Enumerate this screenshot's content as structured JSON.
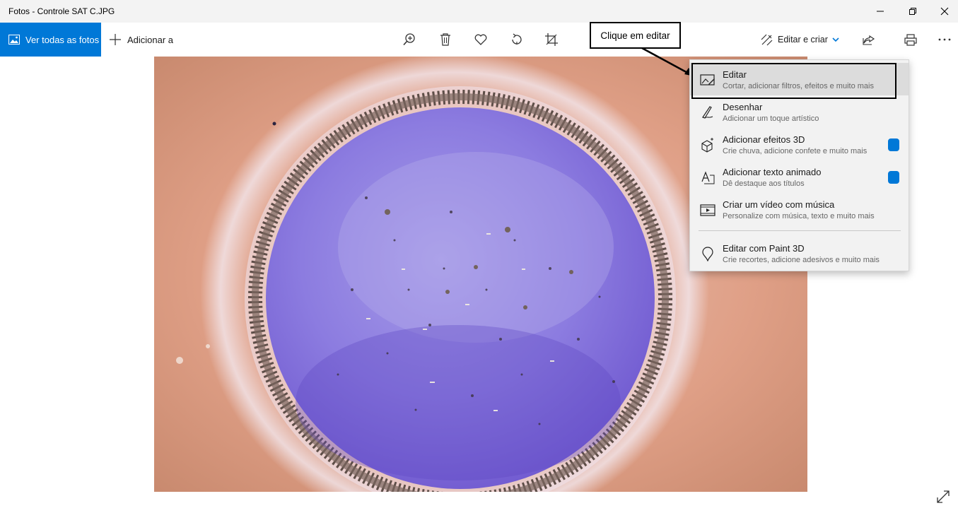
{
  "window": {
    "title": "Fotos - Controle SAT C.JPG"
  },
  "toolbar": {
    "view_all_label": "Ver todas as fotos",
    "add_to_label": "Adicionar a",
    "edit_create_label": "Editar e criar"
  },
  "callout": {
    "text": "Clique em editar"
  },
  "menu": {
    "items": [
      {
        "title": "Editar",
        "subtitle": "Cortar, adicionar filtros, efeitos e muito mais",
        "icon": "edit-image-icon"
      },
      {
        "title": "Desenhar",
        "subtitle": "Adicionar um toque artístico",
        "icon": "pen-icon"
      },
      {
        "title": "Adicionar efeitos 3D",
        "subtitle": "Crie chuva, adicione confete e muito mais",
        "icon": "cube-sparkle-icon"
      },
      {
        "title": "Adicionar texto animado",
        "subtitle": "Dê destaque aos títulos",
        "icon": "animated-text-icon"
      },
      {
        "title": "Criar um vídeo com música",
        "subtitle": "Personalize com música, texto e muito mais",
        "icon": "video-icon"
      },
      {
        "title": "Editar com Paint 3D",
        "subtitle": "Crie recortes, adicione adesivos e muito mais",
        "icon": "paint3d-icon"
      }
    ]
  },
  "colors": {
    "accent": "#0078d7",
    "menu_bg": "#f2f2f2",
    "selected_bg": "#dcdcdc"
  }
}
